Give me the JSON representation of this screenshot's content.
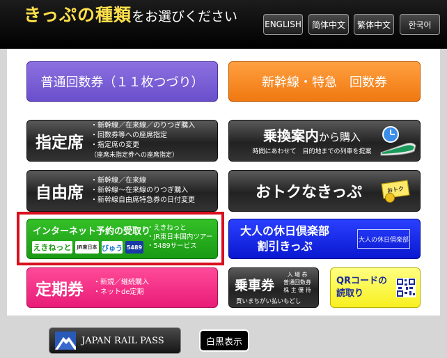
{
  "header": {
    "title_main": "きっぷの種類",
    "title_sub": "をお選びください",
    "languages": [
      "ENGLISH",
      "简体中文",
      "繁体中文",
      "한국어"
    ]
  },
  "buttons": {
    "kaisu": {
      "label": "普通回数券（１１枚つづり）"
    },
    "shinkansen_kaisu": {
      "label": "新幹線・特急　回数券"
    },
    "shitei": {
      "label": "指定席",
      "notes": [
        "・新幹線／在来線／のりつぎ購入",
        "・回数券等への座席指定",
        "・指定席の変更",
        "（座席未指定券への座席指定）"
      ]
    },
    "norikae": {
      "label_main": "乗換案内",
      "label_suffix": "から購入",
      "sub": "時間にあわせて　目的地までの列車を提案"
    },
    "jiyu": {
      "label": "自由席",
      "notes": [
        "・新幹線／在来線",
        "・新幹線～在来線のりつぎ購入",
        "・新幹線自由席特急券の日付変更"
      ]
    },
    "otoku": {
      "label": "おトクなきっぷ",
      "icon_text": "おトク"
    },
    "internet": {
      "label": "インターネット予約の受取り",
      "notes": [
        "・えきねっと",
        "・JR東日本国内ツアー",
        "・5489サービス"
      ],
      "chips": [
        "えきねっと",
        "JR東日本",
        "びゅう",
        "5489"
      ]
    },
    "otona": {
      "label_line1": "大人の休日倶楽部",
      "label_line2": "割引きっぷ",
      "logo_text": "大人の休日倶楽部"
    },
    "teiki": {
      "label": "定期券",
      "notes": [
        "・新規／継続購入",
        "・ネットde定期"
      ]
    },
    "joshaken": {
      "label": "乗車券",
      "side_lines": [
        "入 場 券",
        "普通回数券",
        "株 主 優 待"
      ],
      "bottom": "買いまちがい払いもどし"
    },
    "qr": {
      "label_line1": "QRコードの",
      "label_line2": "読取り"
    }
  },
  "footer": {
    "jrpass": "JAPAN RAIL PASS",
    "monochrome": "白黒表示"
  }
}
